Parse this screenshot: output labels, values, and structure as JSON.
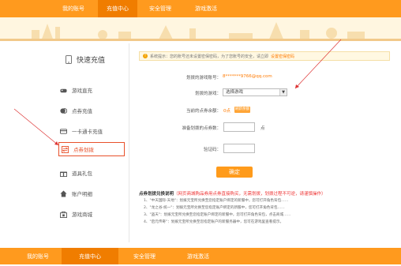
{
  "nav_top": {
    "items": [
      {
        "label": "我的账号",
        "active": false
      },
      {
        "label": "充值中心",
        "active": true
      },
      {
        "label": "安全管理",
        "active": false
      },
      {
        "label": "游戏激活",
        "active": false
      }
    ]
  },
  "nav_bottom": {
    "items": [
      {
        "label": "我的账号",
        "active": false
      },
      {
        "label": "充值中心",
        "active": true
      },
      {
        "label": "安全管理",
        "active": false
      },
      {
        "label": "游戏激活",
        "active": false
      }
    ]
  },
  "sidebar": {
    "title": "快速充值",
    "items": [
      {
        "label": "游戏直充",
        "icon": "gamepad-icon",
        "active": false
      },
      {
        "label": "点券充值",
        "icon": "coins-icon",
        "active": false
      },
      {
        "label": "一卡通卡充值",
        "icon": "card-icon",
        "active": false
      },
      {
        "label": "点券划拨",
        "icon": "transfer-icon",
        "active": true
      },
      {
        "label": "道具礼包",
        "icon": "gift-icon",
        "active": false
      },
      {
        "label": "账户明细",
        "icon": "home-icon",
        "active": false
      },
      {
        "label": "游戏商城",
        "icon": "store-icon",
        "active": false
      }
    ]
  },
  "notice": {
    "text": "系统提示：您的账号还未设置密保密码，为了您账号的安全，请立即",
    "link": "设置密保密码"
  },
  "form": {
    "account_label": "划拨的游戏账号：",
    "account_value": "8*******9766@qq.com",
    "game_label": "划拨的游戏：",
    "game_select": "选择游戏",
    "balance_label": "当前的点券余额：",
    "balance_value": "0点",
    "balance_button": "刷新余额",
    "amount_label": "准备划拨的点券数：",
    "amount_unit": "点",
    "captcha_label": "验证码：",
    "confirm_label": "确定"
  },
  "instructions": {
    "title": "点券划拨兑换说明",
    "warning": "（网页商城购品券用点券直接购买，无需划拨，划拨过程不可逆，请谨慎操作）",
    "lines": [
      "1、\"中天国际-天地\"：划拨元宝所兑换至您指定账户绑定的新服中，您可打开角色背包……",
      "2、\"龙之谷-统一\"：划拨元宝所兑换至您指定账户绑定的新服中，您可打开角色背包……",
      "3、\"盗天\"：划拨元宝所兑换至您指定账户绑定的新服中，您可打开角色背包，点击商城……",
      "4、\"启元传奇\"：划拨元宝所兑换至您指定账户的新服务器中，您可在游戏里查看提示。"
    ]
  },
  "colors": {
    "nav_bg": "#ff9a1e",
    "nav_active": "#f07d00",
    "accent": "#ff7a00",
    "highlight_border": "#e8512b"
  }
}
